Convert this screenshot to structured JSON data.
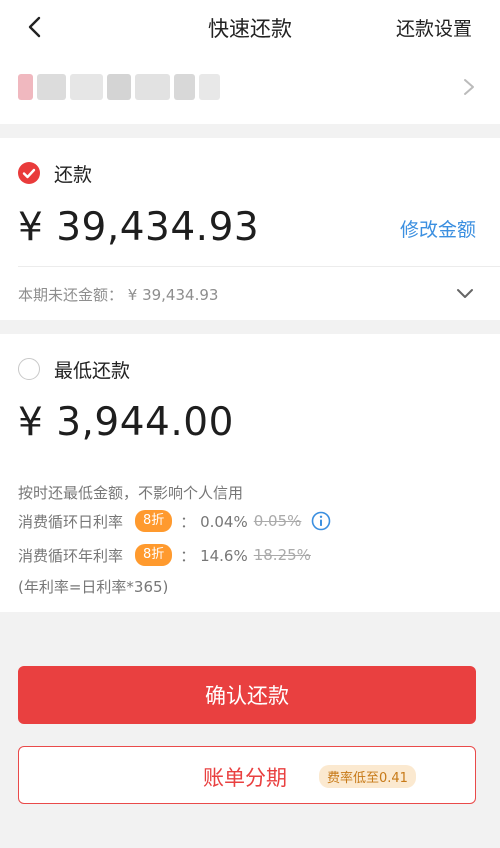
{
  "header": {
    "title": "快速还款",
    "settings_label": "还款设置",
    "back_icon": "chevron-left-icon"
  },
  "account": {
    "masked_name": "",
    "chevron_icon": "chevron-right-icon"
  },
  "full_repayment": {
    "selected": true,
    "label": "还款",
    "amount": "¥ 39,434.93",
    "edit_label": "修改金额",
    "unpaid_text": "本期未还金额： ¥ 39,434.93",
    "expand_icon": "chevron-down-icon"
  },
  "min_repayment": {
    "selected": false,
    "label": "最低还款",
    "amount": "¥ 3,944.00",
    "note": "按时还最低金额，不影响个人信用",
    "daily_rate_label": "消费循环日利率",
    "daily_badge": "8折",
    "daily_rate": "： 0.04%",
    "daily_rate_old": "0.05%",
    "annual_rate_label": "消费循环年利率",
    "annual_badge": "8折",
    "annual_rate": "： 14.6%",
    "annual_rate_old": "18.25%",
    "formula": "(年利率=日利率*365)"
  },
  "actions": {
    "confirm_label": "确认还款",
    "installment_label": "账单分期",
    "installment_rate": "费率低至0.41"
  },
  "colors": {
    "accent_red": "#e94040",
    "link_blue": "#3b8fe0",
    "badge_orange": "#ff9a2e"
  }
}
